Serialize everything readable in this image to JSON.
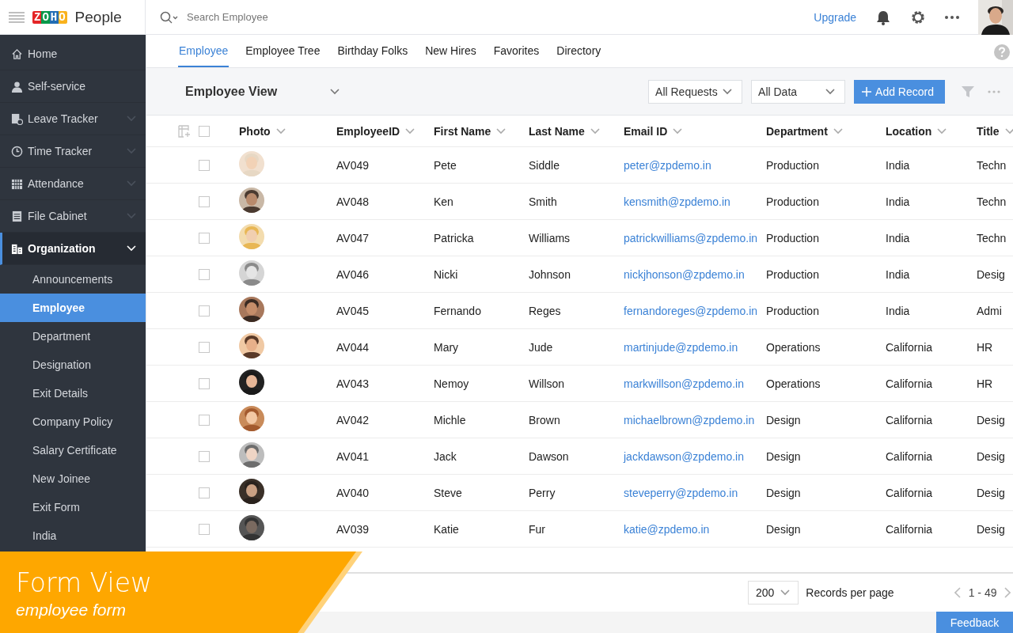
{
  "header": {
    "brand": "ZOHO",
    "product": "People",
    "search": {
      "placeholder": "Search Employee"
    },
    "upgrade": "Upgrade"
  },
  "sidebar": {
    "items": [
      {
        "label": "Home",
        "kind": "link",
        "selected": false
      },
      {
        "label": "Self-service",
        "kind": "link",
        "selected": false
      },
      {
        "label": "Leave Tracker",
        "kind": "group",
        "selected": false,
        "expanded": false
      },
      {
        "label": "Time Tracker",
        "kind": "group",
        "selected": false,
        "expanded": false
      },
      {
        "label": "Attendance",
        "kind": "group",
        "selected": false,
        "expanded": false
      },
      {
        "label": "File Cabinet",
        "kind": "group",
        "selected": false,
        "expanded": false
      },
      {
        "label": "Organization",
        "kind": "group",
        "selected": true,
        "expanded": true,
        "children": [
          {
            "label": "Announcements",
            "selected": false
          },
          {
            "label": "Employee",
            "selected": true
          },
          {
            "label": "Department",
            "selected": false
          },
          {
            "label": "Designation",
            "selected": false
          },
          {
            "label": "Exit Details",
            "selected": false
          },
          {
            "label": "Company Policy",
            "selected": false
          },
          {
            "label": "Salary Certificate",
            "selected": false
          },
          {
            "label": "New Joinee",
            "selected": false
          },
          {
            "label": "Exit Form",
            "selected": false
          },
          {
            "label": "India",
            "selected": false
          }
        ]
      }
    ]
  },
  "tabs": [
    {
      "label": "Employee",
      "selected": true
    },
    {
      "label": "Employee Tree",
      "selected": false
    },
    {
      "label": "Birthday Folks",
      "selected": false
    },
    {
      "label": "New Hires",
      "selected": false
    },
    {
      "label": "Favorites",
      "selected": false
    },
    {
      "label": "Directory",
      "selected": false
    }
  ],
  "toolbar": {
    "view": "Employee View",
    "filters": [
      "All Requests",
      "All Data"
    ],
    "add_button": "Add Record"
  },
  "table": {
    "all_selected": false,
    "columns": [
      {
        "label": "Photo"
      },
      {
        "label": "EmployeeID",
        "kind": "text"
      },
      {
        "label": "First Name",
        "kind": "text"
      },
      {
        "label": "Last Name",
        "kind": "text"
      },
      {
        "label": "Email ID",
        "kind": "email"
      },
      {
        "label": "Department",
        "kind": "text"
      },
      {
        "label": "Location",
        "kind": "text"
      },
      {
        "label": "Title",
        "kind": "text"
      }
    ],
    "rows": [
      {
        "checked": false,
        "cells": [
          "",
          "AV049",
          "Pete",
          "Siddle",
          "peter@zpdemo.in",
          "Production",
          "India",
          "Techn"
        ]
      },
      {
        "checked": false,
        "cells": [
          "",
          "AV048",
          "Ken",
          "Smith",
          "kensmith@zpdemo.in",
          "Production",
          "India",
          "Techn"
        ]
      },
      {
        "checked": false,
        "cells": [
          "",
          "AV047",
          "Patricka",
          "Williams",
          "patrickwilliams@zpdemo.in",
          "Production",
          "India",
          "Techn"
        ]
      },
      {
        "checked": false,
        "cells": [
          "",
          "AV046",
          "Nicki",
          "Johnson",
          "nickjhonson@zpdemo.in",
          "Production",
          "India",
          "Desig"
        ]
      },
      {
        "checked": false,
        "cells": [
          "",
          "AV045",
          "Fernando",
          "Reges",
          "fernandoreges@zpdemo.in",
          "Production",
          "India",
          "Admi"
        ]
      },
      {
        "checked": false,
        "cells": [
          "",
          "AV044",
          "Mary",
          "Jude",
          "martinjude@zpdemo.in",
          "Operations",
          "California",
          "HR"
        ]
      },
      {
        "checked": false,
        "cells": [
          "",
          "AV043",
          "Nemoy",
          "Willson",
          "markwillson@zpdemo.in",
          "Operations",
          "California",
          "HR"
        ]
      },
      {
        "checked": false,
        "cells": [
          "",
          "AV042",
          "Michle",
          "Brown",
          "michaelbrown@zpdemo.in",
          "Design",
          "California",
          "Desig"
        ]
      },
      {
        "checked": false,
        "cells": [
          "",
          "AV041",
          "Jack",
          "Dawson",
          "jackdawson@zpdemo.in",
          "Design",
          "California",
          "Desig"
        ]
      },
      {
        "checked": false,
        "cells": [
          "",
          "AV040",
          "Steve",
          "Perry",
          "steveperry@zpdemo.in",
          "Design",
          "California",
          "Desig"
        ]
      },
      {
        "checked": false,
        "cells": [
          "",
          "AV039",
          "Katie",
          "Fur",
          "katie@zpdemo.in",
          "Design",
          "California",
          "Desig"
        ]
      }
    ]
  },
  "pagination": {
    "per_page": "200",
    "per_page_label": "Records per page",
    "range": "1 - 49"
  },
  "feedback": "Feedback",
  "caption": {
    "title": "Form View",
    "subtitle": "employee form"
  }
}
